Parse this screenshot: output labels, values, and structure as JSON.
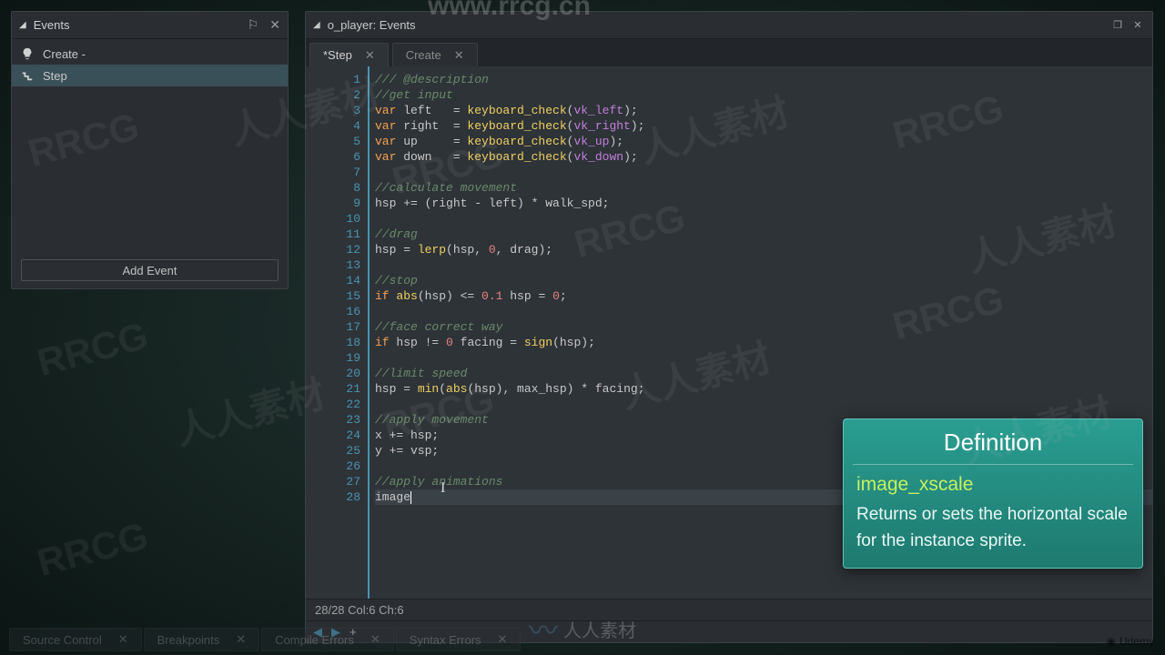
{
  "events_panel": {
    "title": "Events",
    "items": [
      {
        "label": "Create -"
      },
      {
        "label": "Step"
      }
    ],
    "add_button": "Add Event"
  },
  "code_panel": {
    "title": "o_player: Events",
    "tabs": [
      {
        "label": "*Step",
        "active": true
      },
      {
        "label": "Create",
        "active": false
      }
    ],
    "status": "28/28 Col:6 Ch:6",
    "code_lines": [
      "/// @description",
      "//get input",
      "var left   = keyboard_check(vk_left);",
      "var right  = keyboard_check(vk_right);",
      "var up     = keyboard_check(vk_up);",
      "var down   = keyboard_check(vk_down);",
      "",
      "//calculate movement",
      "hsp += (right - left) * walk_spd;",
      "",
      "//drag",
      "hsp = lerp(hsp, 0, drag);",
      "",
      "//stop",
      "if abs(hsp) <= 0.1 hsp = 0;",
      "",
      "//face correct way",
      "if hsp != 0 facing = sign(hsp);",
      "",
      "//limit speed",
      "hsp = min(abs(hsp), max_hsp) * facing;",
      "",
      "//apply movement",
      "x += hsp;",
      "y += vsp;",
      "",
      "//apply animations",
      "image"
    ],
    "current_line_text": "image"
  },
  "tooltip": {
    "title": "Definition",
    "term": "image_xscale",
    "description": "Returns or sets the horizontal scale for the instance sprite."
  },
  "bottom_tabs": [
    "Source Control",
    "Breakpoints",
    "Compile Errors",
    "Syntax Errors"
  ],
  "watermarks": {
    "url": "www.rrcg.cn",
    "repeat": "RRCG",
    "cn": "人人素材"
  },
  "udemy": "Udemy"
}
